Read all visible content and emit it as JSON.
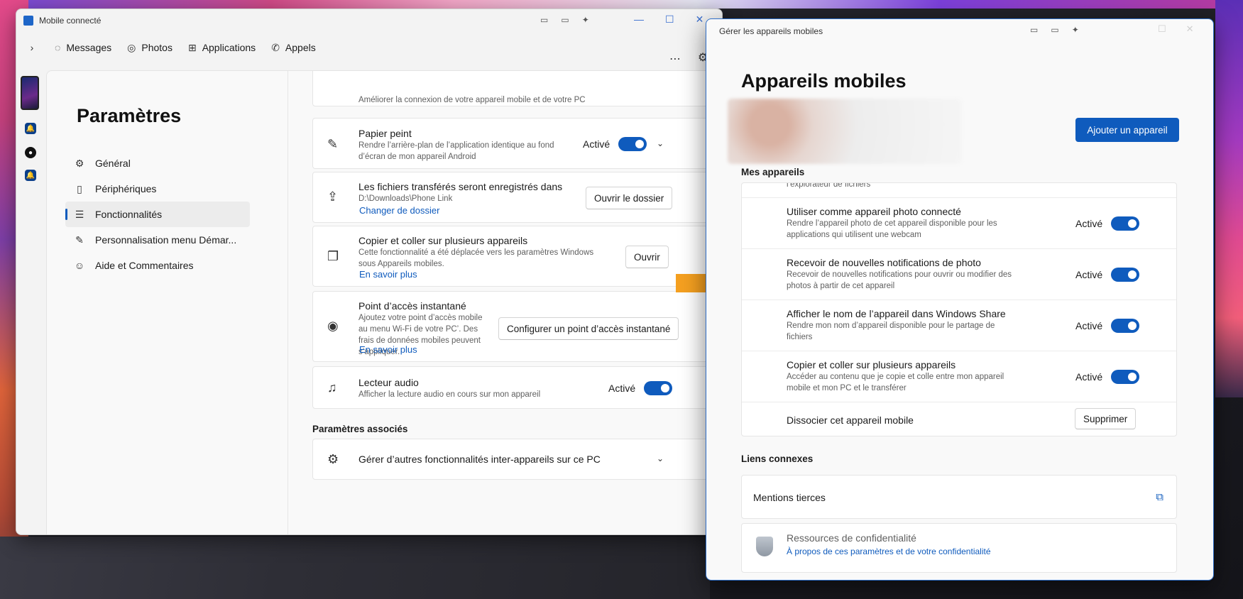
{
  "main_window": {
    "title": "Mobile connecté",
    "nav": {
      "messages": "Messages",
      "photos": "Photos",
      "applications": "Applications",
      "appels": "Appels"
    },
    "page_title": "Paramètres",
    "menu": [
      {
        "label": "Général",
        "icon": "gear-icon"
      },
      {
        "label": "Périphériques",
        "icon": "phone-icon"
      },
      {
        "label": "Fonctionnalités",
        "icon": "list-icon"
      },
      {
        "label": "Personnalisation menu Démar...",
        "icon": "pencil-icon"
      },
      {
        "label": "Aide et Commentaires",
        "icon": "help-icon"
      }
    ],
    "partial_top_text": "Améliorer la connexion de votre appareil mobile et de votre PC",
    "cards": {
      "wallpaper": {
        "title": "Papier peint",
        "desc": "Rendre l’arrière-plan de l’application identique au fond d’écran de mon appareil Android",
        "state": "Activé"
      },
      "files": {
        "title": "Les fichiers transférés seront enregistrés dans",
        "path": "D:\\Downloads\\Phone Link",
        "link": "Changer de dossier",
        "button": "Ouvrir le dossier"
      },
      "copy_paste": {
        "title": "Copier et coller sur plusieurs appareils",
        "desc": "Cette fonctionnalité a été déplacée vers les paramètres Windows sous Appareils mobiles.",
        "link": "En savoir plus",
        "button": "Ouvrir"
      },
      "hotspot": {
        "title": "Point d’accès instantané",
        "desc": "Ajoutez votre point d’accès mobile au menu Wi-Fi de votre PC’. Des frais de données mobiles peuvent s’appliquer.",
        "link": "En savoir plus",
        "button": "Configurer un point d’accès instantané"
      },
      "audio": {
        "title": "Lecteur audio",
        "desc": "Afficher la lecture audio en cours sur mon appareil",
        "state": "Activé"
      }
    },
    "related_label": "Paramètres associés",
    "related_item": "Gérer d’autres fonctionnalités inter-appareils sur ce PC"
  },
  "device_window": {
    "title": "Gérer les appareils mobiles",
    "heading": "Appareils mobiles",
    "add_button": "Ajouter un appareil",
    "my_devices": "Mes appareils",
    "clipped_text": "l’explorateur de fichiers",
    "rows": [
      {
        "title": "Utiliser comme appareil photo connecté",
        "desc": "Rendre l’appareil photo de cet appareil disponible pour les applications qui utilisent une webcam",
        "state": "Activé"
      },
      {
        "title": "Recevoir de nouvelles notifications de photo",
        "desc": "Recevoir de nouvelles notifications pour ouvrir ou modifier des photos à partir de cet appareil",
        "state": "Activé"
      },
      {
        "title": "Afficher le nom de l’appareil dans Windows Share",
        "desc": "Rendre mon nom d’appareil disponible pour le partage de fichiers",
        "state": "Activé"
      },
      {
        "title": "Copier et coller sur plusieurs appareils",
        "desc": "Accéder au contenu que je copie et colle entre mon appareil mobile et mon PC et le transférer",
        "state": "Activé"
      }
    ],
    "dissociate": {
      "title": "Dissocier cet appareil mobile",
      "button": "Supprimer"
    },
    "related_links": "Liens connexes",
    "third_party": "Mentions tierces",
    "privacy": {
      "title": "Ressources de confidentialité",
      "link": "À propos de ces paramètres et de votre confidentialité"
    }
  },
  "colors": {
    "accent": "#0f5bbd",
    "arrow": "#f5a020"
  }
}
